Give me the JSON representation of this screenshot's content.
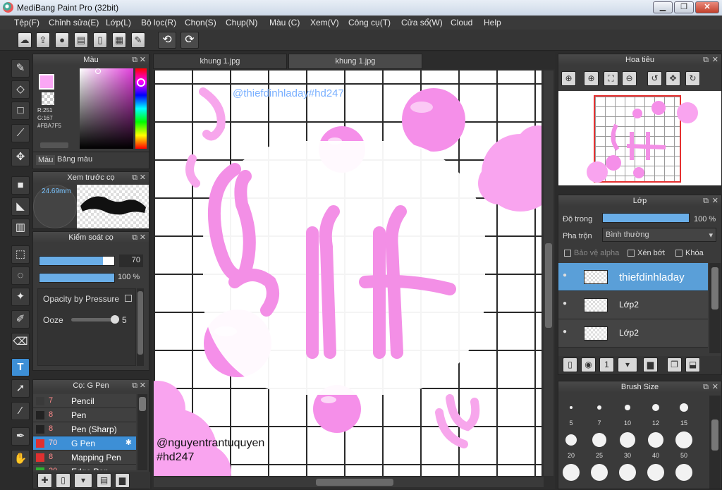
{
  "window": {
    "title": "MediBang Paint Pro (32bit)",
    "min": "▁",
    "max": "❐",
    "close": "✕"
  },
  "menu": [
    "Tệp(F)",
    "Chỉnh sửa(E)",
    "Lớp(L)",
    "Bộ lọc(R)",
    "Chọn(S)",
    "Chụp(N)",
    "Màu (C)",
    "Xem(V)",
    "Công cụ(T)",
    "Cửa sổ(W)",
    "Cloud",
    "Help"
  ],
  "toolbar": {
    "icons": [
      "cloud-icon",
      "upload-icon",
      "comment-icon",
      "message-icon",
      "page-icon",
      "layout-icon",
      "edit-icon"
    ],
    "undo": "⟲",
    "redo": "⟳"
  },
  "color_panel": {
    "title": "Màu",
    "r": "R:251",
    "g": "G:167",
    "hex": "#FBA7F5",
    "tab1": "Màu",
    "tab2": "Bảng màu",
    "fg": "#fba7f5",
    "bg": "#ffffff"
  },
  "preview_panel": {
    "title": "Xem trước cọ",
    "size": "24.69mm"
  },
  "control_panel": {
    "title": "Kiểm soát cọ",
    "size": "70",
    "opacity": "100 %",
    "opacity_pressure": "Opacity by Pressure",
    "ooze": "Ooze",
    "ooze_val": "5",
    "size_fill": 0.85,
    "opacity_fill": 1.0
  },
  "brush_panel": {
    "title": "Cọ: G Pen",
    "items": [
      {
        "size": "7",
        "name": "Pencil",
        "color": "#3a3a3a",
        "active": false
      },
      {
        "size": "8",
        "name": "Pen",
        "color": "#222222",
        "active": false
      },
      {
        "size": "8",
        "name": "Pen (Sharp)",
        "color": "#222222",
        "active": false
      },
      {
        "size": "70",
        "name": "G Pen",
        "color": "#e03030",
        "active": true
      },
      {
        "size": "8",
        "name": "Mapping Pen",
        "color": "#e03030",
        "active": false
      },
      {
        "size": "20",
        "name": "Edge Pen",
        "color": "#30b030",
        "active": false
      }
    ]
  },
  "tabs": [
    "khung 1.jpg",
    "khung 1.jpg"
  ],
  "canvas_text": {
    "watermark_top": "@thiefdinhladay#hd247",
    "credit1": "@nguyentrantuquyen",
    "credit2": "#hd247"
  },
  "navigator": {
    "title": "Hoa tiêu"
  },
  "layer_panel": {
    "title": "Lớp",
    "opacity_label": "Độ trong",
    "opacity_val": "100 %",
    "opacity_fill": 1.0,
    "blend_label": "Pha trộn",
    "blend_val": "Bình thường",
    "protect_alpha": "Bảo vệ alpha",
    "clip": "Xén bớt",
    "lock": "Khóa",
    "layers": [
      {
        "name": "thiefdinhladay",
        "selected": true
      },
      {
        "name": "Lớp2",
        "selected": false
      },
      {
        "name": "Lớp2",
        "selected": false
      }
    ]
  },
  "brush_size_panel": {
    "title": "Brush Size",
    "sizes": [
      "5",
      "7",
      "10",
      "12",
      "15",
      "20",
      "25",
      "30",
      "40",
      "50"
    ]
  }
}
